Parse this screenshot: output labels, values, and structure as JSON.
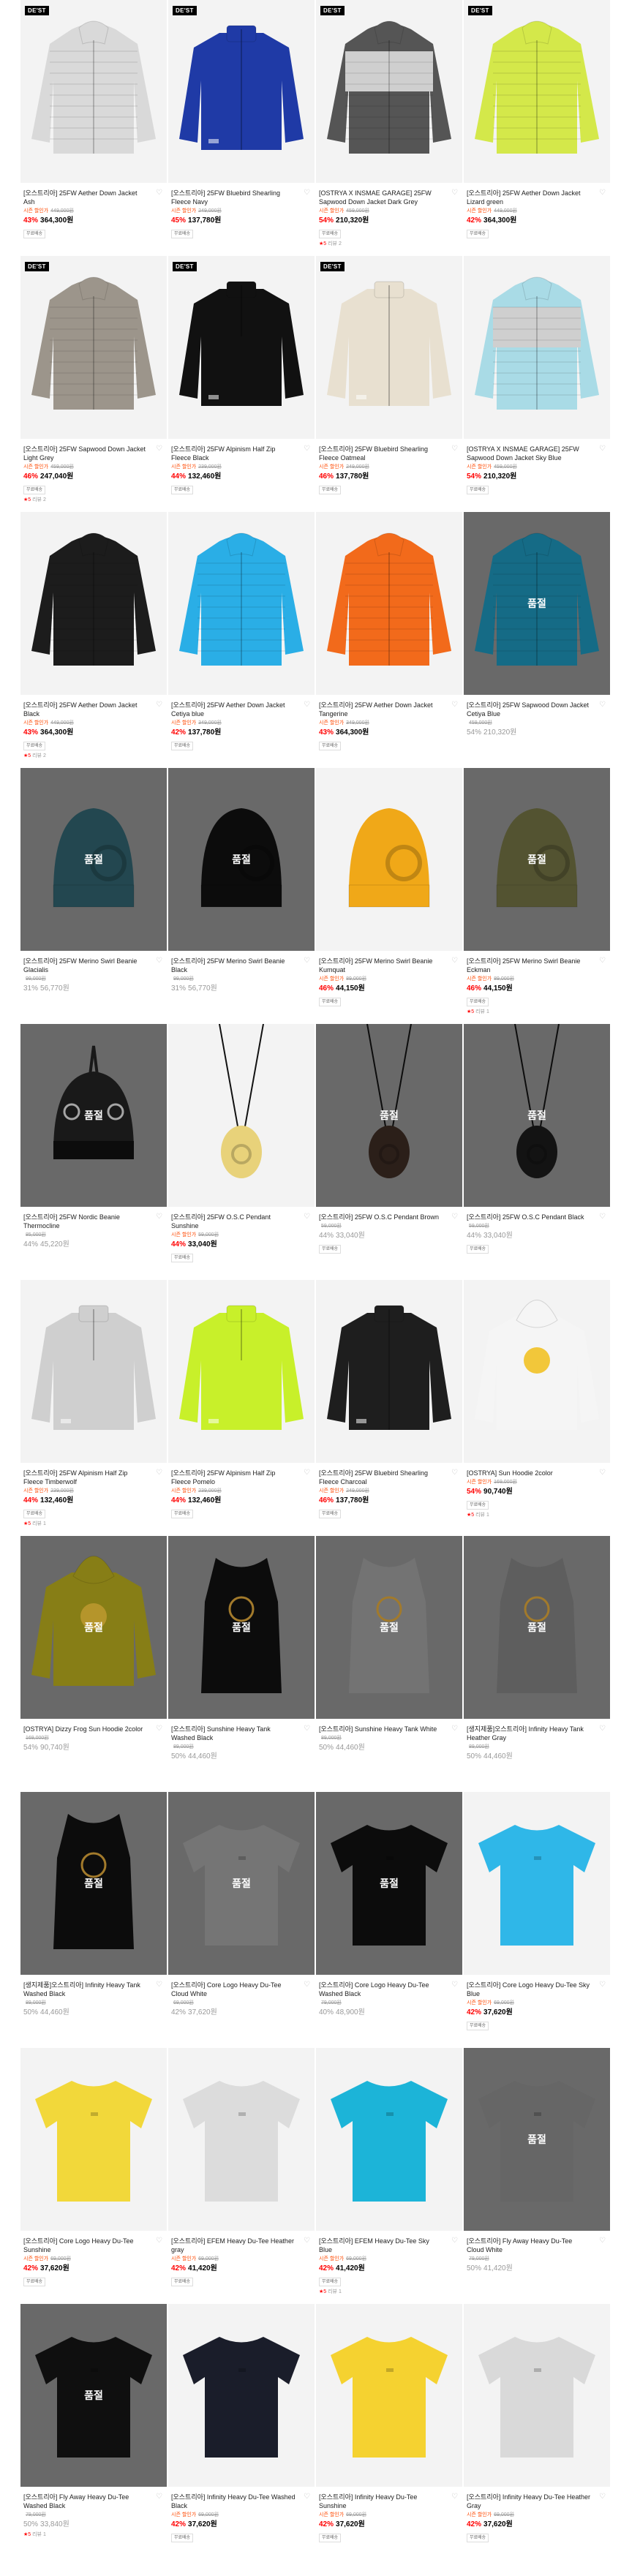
{
  "products": [
    {
      "badge": "DE'ST",
      "title": "[오스트리아] 25FW Aether Down Jacket Ash",
      "sub": "시즌 할인가",
      "orig": "449,000원",
      "pct": "43%",
      "price": "364,300원",
      "muted": false,
      "tag": "무료배송",
      "rating": "",
      "review": "",
      "img": "puffer",
      "color": "#d9d9d9",
      "bg": "bg-white"
    },
    {
      "badge": "DE'ST",
      "title": "[오스트리아] 25FW Bluebird Shearling Fleece Navy",
      "sub": "시즌 할인가",
      "orig": "249,000원",
      "pct": "45%",
      "price": "137,780원",
      "muted": false,
      "tag": "무료배송",
      "rating": "",
      "review": "",
      "img": "fleece",
      "color": "#1f3aa6",
      "bg": "bg-white"
    },
    {
      "badge": "DE'ST",
      "title": "[OSTRYA X INSMAE GARAGE] 25FW Sapwood Down Jacket Dark Grey",
      "sub": "시즌 할인가",
      "orig": "459,000원",
      "pct": "54%",
      "price": "210,320원",
      "muted": false,
      "tag": "무료배송",
      "rating": "★5",
      "review": "리뷰 2",
      "img": "puffer-block",
      "color": "#555555",
      "bg": "bg-white"
    },
    {
      "badge": "DE'ST",
      "title": "[오스트리아] 25FW Aether Down Jacket Lizard green",
      "sub": "시즌 할인가",
      "orig": "449,000원",
      "pct": "42%",
      "price": "364,300원",
      "muted": false,
      "tag": "무료배송",
      "rating": "",
      "review": "",
      "img": "puffer",
      "color": "#d4e84a",
      "bg": "bg-white"
    },
    {
      "badge": "DE'ST",
      "title": "[오스트리아] 25FW Sapwood Down Jacket Light Grey",
      "sub": "시즌 할인가",
      "orig": "459,000원",
      "pct": "46%",
      "price": "247,040원",
      "muted": false,
      "tag": "무료배송",
      "rating": "★5",
      "review": "리뷰 2",
      "img": "puffer",
      "color": "#9c958b",
      "bg": "bg-white"
    },
    {
      "badge": "DE'ST",
      "title": "[오스트리아] 25FW Alpinism Half Zip Fleece Black",
      "sub": "시즌 할인가",
      "orig": "239,000원",
      "pct": "44%",
      "price": "132,460원",
      "muted": false,
      "tag": "무료배송",
      "rating": "",
      "review": "",
      "img": "halfzip",
      "color": "#111111",
      "bg": "bg-white"
    },
    {
      "badge": "DE'ST",
      "title": "[오스트리아] 25FW Bluebird Shearling Fleece Oatmeal",
      "sub": "시즌 할인가",
      "orig": "249,000원",
      "pct": "46%",
      "price": "137,780원",
      "muted": false,
      "tag": "무료배송",
      "rating": "",
      "review": "",
      "img": "fleece",
      "color": "#e8e0d0",
      "bg": "bg-white"
    },
    {
      "badge": "",
      "title": "[OSTRYA X INSMAE GARAGE] 25FW Sapwood Down Jacket Sky Blue",
      "sub": "시즌 할인가",
      "orig": "459,000원",
      "pct": "54%",
      "price": "210,320원",
      "muted": false,
      "tag": "무료배송",
      "rating": "",
      "review": "",
      "img": "puffer-block",
      "color": "#a9dbe6",
      "bg": "bg-white"
    },
    {
      "badge": "",
      "title": "[오스트리아] 25FW Aether Down Jacket Black",
      "sub": "시즌 할인가",
      "orig": "449,000원",
      "pct": "43%",
      "price": "364,300원",
      "muted": false,
      "tag": "무료배송",
      "rating": "★5",
      "review": "리뷰 2",
      "img": "puffer",
      "color": "#1c1c1c",
      "bg": "bg-white"
    },
    {
      "badge": "",
      "title": "[오스트리아] 25FW Aether Down Jacket Cetiya blue",
      "sub": "시즌 할인가",
      "orig": "349,000원",
      "pct": "42%",
      "price": "137,780원",
      "muted": false,
      "tag": "무료배송",
      "rating": "",
      "review": "",
      "img": "puffer",
      "color": "#2aaee6",
      "bg": "bg-white"
    },
    {
      "badge": "",
      "title": "[오스트리아] 25FW Aether Down Jacket Tangerine",
      "sub": "시즌 할인가",
      "orig": "349,000원",
      "pct": "43%",
      "price": "364,300원",
      "muted": false,
      "tag": "무료배송",
      "rating": "",
      "review": "",
      "img": "puffer",
      "color": "#f26a1b",
      "bg": "bg-white"
    },
    {
      "badge": "",
      "title": "[오스트리아] 25FW Sapwood Down Jacket Cetiya Blue",
      "sub": "",
      "orig": "459,000원",
      "pct": "54%",
      "price": "210,320원",
      "muted": true,
      "tag": "",
      "rating": "",
      "review": "",
      "img": "soldout-puffer",
      "color": "#1d8fb3",
      "bg": "bg-dark"
    },
    {
      "badge": "",
      "title": "[오스트리아] 25FW Merino Swirl Beanie Glacialis",
      "sub": "",
      "orig": "99,000원",
      "pct": "31%",
      "price": "56,770원",
      "muted": true,
      "tag": "",
      "rating": "",
      "review": "",
      "img": "soldout-beanie",
      "color": "#2f5f6b",
      "bg": "bg-dark"
    },
    {
      "badge": "",
      "title": "[오스트리아] 25FW Merino Swirl Beanie Black",
      "sub": "",
      "orig": "99,000원",
      "pct": "31%",
      "price": "56,770원",
      "muted": true,
      "tag": "",
      "rating": "",
      "review": "",
      "img": "soldout-beanie",
      "color": "#111111",
      "bg": "bg-dark"
    },
    {
      "badge": "",
      "title": "[오스트리아] 25FW Merino Swirl Beanie Kumquat",
      "sub": "시즌 할인가",
      "orig": "89,000원",
      "pct": "46%",
      "price": "44,150원",
      "muted": false,
      "tag": "무료배송",
      "rating": "",
      "review": "",
      "img": "beanie",
      "color": "#f0a818",
      "bg": "bg-white"
    },
    {
      "badge": "",
      "title": "[오스트리아] 25FW Merino Swirl Beanie Eckman",
      "sub": "시즌 할인가",
      "orig": "89,000원",
      "pct": "46%",
      "price": "44,150원",
      "muted": false,
      "tag": "무료배송",
      "rating": "★5",
      "review": "리뷰 1",
      "img": "soldout-beanie",
      "color": "#6f6f42",
      "bg": "bg-dark"
    },
    {
      "badge": "",
      "title": "[오스트리아] 25FW Nordic Beanie Thermocline",
      "sub": "",
      "orig": "85,000원",
      "pct": "44%",
      "price": "45,220원",
      "muted": true,
      "tag": "",
      "rating": "",
      "review": "",
      "img": "soldout-nordic",
      "color": "#222222",
      "bg": "bg-dark"
    },
    {
      "badge": "",
      "title": "[오스트리아] 25FW O.S.C Pendant Sunshine",
      "sub": "시즌 할인가",
      "orig": "59,000원",
      "pct": "44%",
      "price": "33,040원",
      "muted": false,
      "tag": "무료배송",
      "rating": "",
      "review": "",
      "img": "pendant",
      "color": "#e8d27a",
      "bg": "bg-white"
    },
    {
      "badge": "",
      "title": "[오스트리아] 25FW O.S.C Pendant Brown",
      "sub": "",
      "orig": "59,000원",
      "pct": "44%",
      "price": "33,040원",
      "muted": true,
      "tag": "무료배송",
      "rating": "",
      "review": "",
      "img": "soldout-pendant",
      "color": "#3a2a22",
      "bg": "bg-dark"
    },
    {
      "badge": "",
      "title": "[오스트리아] 25FW O.S.C Pendant Black",
      "sub": "",
      "orig": "59,000원",
      "pct": "44%",
      "price": "33,040원",
      "muted": true,
      "tag": "무료배송",
      "rating": "",
      "review": "",
      "img": "soldout-pendant",
      "color": "#1a1a1a",
      "bg": "bg-dark"
    },
    {
      "badge": "",
      "title": "[오스트리아] 25FW Alpinism Half Zip Fleece Timberwolf",
      "sub": "시즌 할인가",
      "orig": "239,000원",
      "pct": "44%",
      "price": "132,460원",
      "muted": false,
      "tag": "무료배송",
      "rating": "★5",
      "review": "리뷰 1",
      "img": "halfzip",
      "color": "#cfcfcf",
      "bg": "bg-white"
    },
    {
      "badge": "",
      "title": "[오스트리아] 25FW Alpinism Half Zip Fleece Pomelo",
      "sub": "시즌 할인가",
      "orig": "239,000원",
      "pct": "44%",
      "price": "132,460원",
      "muted": false,
      "tag": "무료배송",
      "rating": "",
      "review": "",
      "img": "halfzip",
      "color": "#c8f02a",
      "bg": "bg-white"
    },
    {
      "badge": "",
      "title": "[오스트리아] 25FW Bluebird Shearling Fleece Charcoal",
      "sub": "시즌 할인가",
      "orig": "249,000원",
      "pct": "46%",
      "price": "137,780원",
      "muted": false,
      "tag": "무료배송",
      "rating": "",
      "review": "",
      "img": "fleece",
      "color": "#1e1e1e",
      "bg": "bg-white"
    },
    {
      "badge": "",
      "title": "[OSTRYA] Sun Hoodie 2color",
      "sub": "시즌 할인가",
      "orig": "169,000원",
      "pct": "54%",
      "price": "90,740원",
      "muted": false,
      "tag": "무료배송",
      "rating": "★5",
      "review": "리뷰 1",
      "img": "hoodie-white",
      "color": "#f5f5f5",
      "bg": "bg-white"
    },
    {
      "badge": "",
      "title": "[OSTRYA] Dizzy Frog Sun Hoodie 2color",
      "sub": "",
      "orig": "169,000원",
      "pct": "54%",
      "price": "90,740원",
      "muted": true,
      "tag": "",
      "rating": "",
      "review": "",
      "img": "soldout-hoodie",
      "color": "#b5a81e",
      "bg": "bg-dark"
    },
    {
      "badge": "",
      "title": "[오스트리아] Sunshine Heavy Tank Washed Black",
      "sub": "",
      "orig": "89,000원",
      "pct": "50%",
      "price": "44,460원",
      "muted": true,
      "tag": "",
      "rating": "",
      "review": "",
      "img": "soldout-tank",
      "color": "#111111",
      "bg": "bg-dark"
    },
    {
      "badge": "",
      "title": "[오스트리아] Sunshine Heavy Tank White",
      "sub": "",
      "orig": "89,000원",
      "pct": "50%",
      "price": "44,460원",
      "muted": true,
      "tag": "",
      "rating": "",
      "review": "",
      "img": "soldout-tank",
      "color": "#9a9a9a",
      "bg": "bg-dark"
    },
    {
      "badge": "",
      "title": "[생지제품]오스트리아] Infinity Heavy Tank Heather Gray",
      "sub": "",
      "orig": "89,000원",
      "pct": "50%",
      "price": "44,460원",
      "muted": true,
      "tag": "",
      "rating": "",
      "review": "",
      "img": "soldout-tank",
      "color": "#7e7e7e",
      "bg": "bg-dark"
    },
    {
      "badge": "",
      "title": "[생지제품]오스트리아] Infinity Heavy Tank Washed Black",
      "sub": "",
      "orig": "89,000원",
      "pct": "50%",
      "price": "44,460원",
      "muted": true,
      "tag": "",
      "rating": "",
      "review": "",
      "img": "soldout-tank",
      "color": "#111111",
      "bg": "bg-dark"
    },
    {
      "badge": "",
      "title": "[오스트리아] Core Logo Heavy Du-Tee Cloud White",
      "sub": "",
      "orig": "69,000원",
      "pct": "42%",
      "price": "37,620원",
      "muted": true,
      "tag": "",
      "rating": "",
      "review": "",
      "img": "soldout-tee",
      "color": "#9c9c9c",
      "bg": "bg-dark"
    },
    {
      "badge": "",
      "title": "[오스트리아] Core Logo Heavy Du-Tee Washed Black",
      "sub": "",
      "orig": "79,000원",
      "pct": "40%",
      "price": "48,900원",
      "muted": true,
      "tag": "",
      "rating": "",
      "review": "",
      "img": "soldout-tee",
      "color": "#111111",
      "bg": "bg-dark"
    },
    {
      "badge": "",
      "title": "[오스트리아] Core Logo Heavy Du-Tee Sky Blue",
      "sub": "시즌 할인가",
      "orig": "69,000원",
      "pct": "42%",
      "price": "37,620원",
      "muted": false,
      "tag": "무료배송",
      "rating": "",
      "review": "",
      "img": "tee",
      "color": "#2fb7e8",
      "bg": "bg-white"
    },
    {
      "badge": "",
      "title": "[오스트리아] Core Logo Heavy Du-Tee Sunshine",
      "sub": "시즌 할인가",
      "orig": "69,000원",
      "pct": "42%",
      "price": "37,620원",
      "muted": false,
      "tag": "무료배송",
      "rating": "",
      "review": "",
      "img": "tee",
      "color": "#f2d83a",
      "bg": "bg-white"
    },
    {
      "badge": "",
      "title": "[오스트리아] EFEM Heavy Du-Tee Heather gray",
      "sub": "시즌 할인가",
      "orig": "69,000원",
      "pct": "42%",
      "price": "41,420원",
      "muted": false,
      "tag": "무료배송",
      "rating": "",
      "review": "",
      "img": "tee",
      "color": "#dcdcdc",
      "bg": "bg-white"
    },
    {
      "badge": "",
      "title": "[오스트리아] EFEM Heavy Du-Tee Sky Blue",
      "sub": "시즌 할인가",
      "orig": "69,000원",
      "pct": "42%",
      "price": "41,420원",
      "muted": false,
      "tag": "무료배송",
      "rating": "★5",
      "review": "리뷰 1",
      "img": "tee",
      "color": "#1cb4d8",
      "bg": "bg-white"
    },
    {
      "badge": "",
      "title": "[오스트리아] Fly Away Heavy Du-Tee Cloud White",
      "sub": "",
      "orig": "79,000원",
      "pct": "50%",
      "price": "41,420원",
      "muted": true,
      "tag": "",
      "rating": "",
      "review": "",
      "img": "soldout-tee",
      "color": "#888888",
      "bg": "bg-dark"
    },
    {
      "badge": "",
      "title": "[오스트리아] Fly Away Heavy Du-Tee Washed Black",
      "sub": "",
      "orig": "79,000원",
      "pct": "50%",
      "price": "33,840원",
      "muted": true,
      "tag": "",
      "rating": "★5",
      "review": "리뷰 1",
      "img": "soldout-tee",
      "color": "#151515",
      "bg": "bg-dark"
    },
    {
      "badge": "",
      "title": "[오스트리아] Infinity Heavy Du-Tee Washed Black",
      "sub": "시즌 할인가",
      "orig": "69,000원",
      "pct": "42%",
      "price": "37,620원",
      "muted": false,
      "tag": "무료배송",
      "rating": "",
      "review": "",
      "img": "tee",
      "color": "#1a1d2a",
      "bg": "bg-white"
    },
    {
      "badge": "",
      "title": "[오스트리아] Infinity Heavy Du-Tee Sunshine",
      "sub": "시즌 할인가",
      "orig": "69,000원",
      "pct": "42%",
      "price": "37,620원",
      "muted": false,
      "tag": "무료배송",
      "rating": "",
      "review": "",
      "img": "tee",
      "color": "#f5d230",
      "bg": "bg-white"
    },
    {
      "badge": "",
      "title": "[오스트리아] Infinity Heavy Du-Tee Heather Gray",
      "sub": "시즌 할인가",
      "orig": "69,000원",
      "pct": "42%",
      "price": "37,620원",
      "muted": false,
      "tag": "무료배송",
      "rating": "",
      "review": "",
      "img": "tee",
      "color": "#d9d9d9",
      "bg": "bg-white"
    }
  ],
  "labels": {
    "soldout": "품절",
    "wishlist_icon": "heart-icon",
    "cart_icon": "plus-icon"
  }
}
